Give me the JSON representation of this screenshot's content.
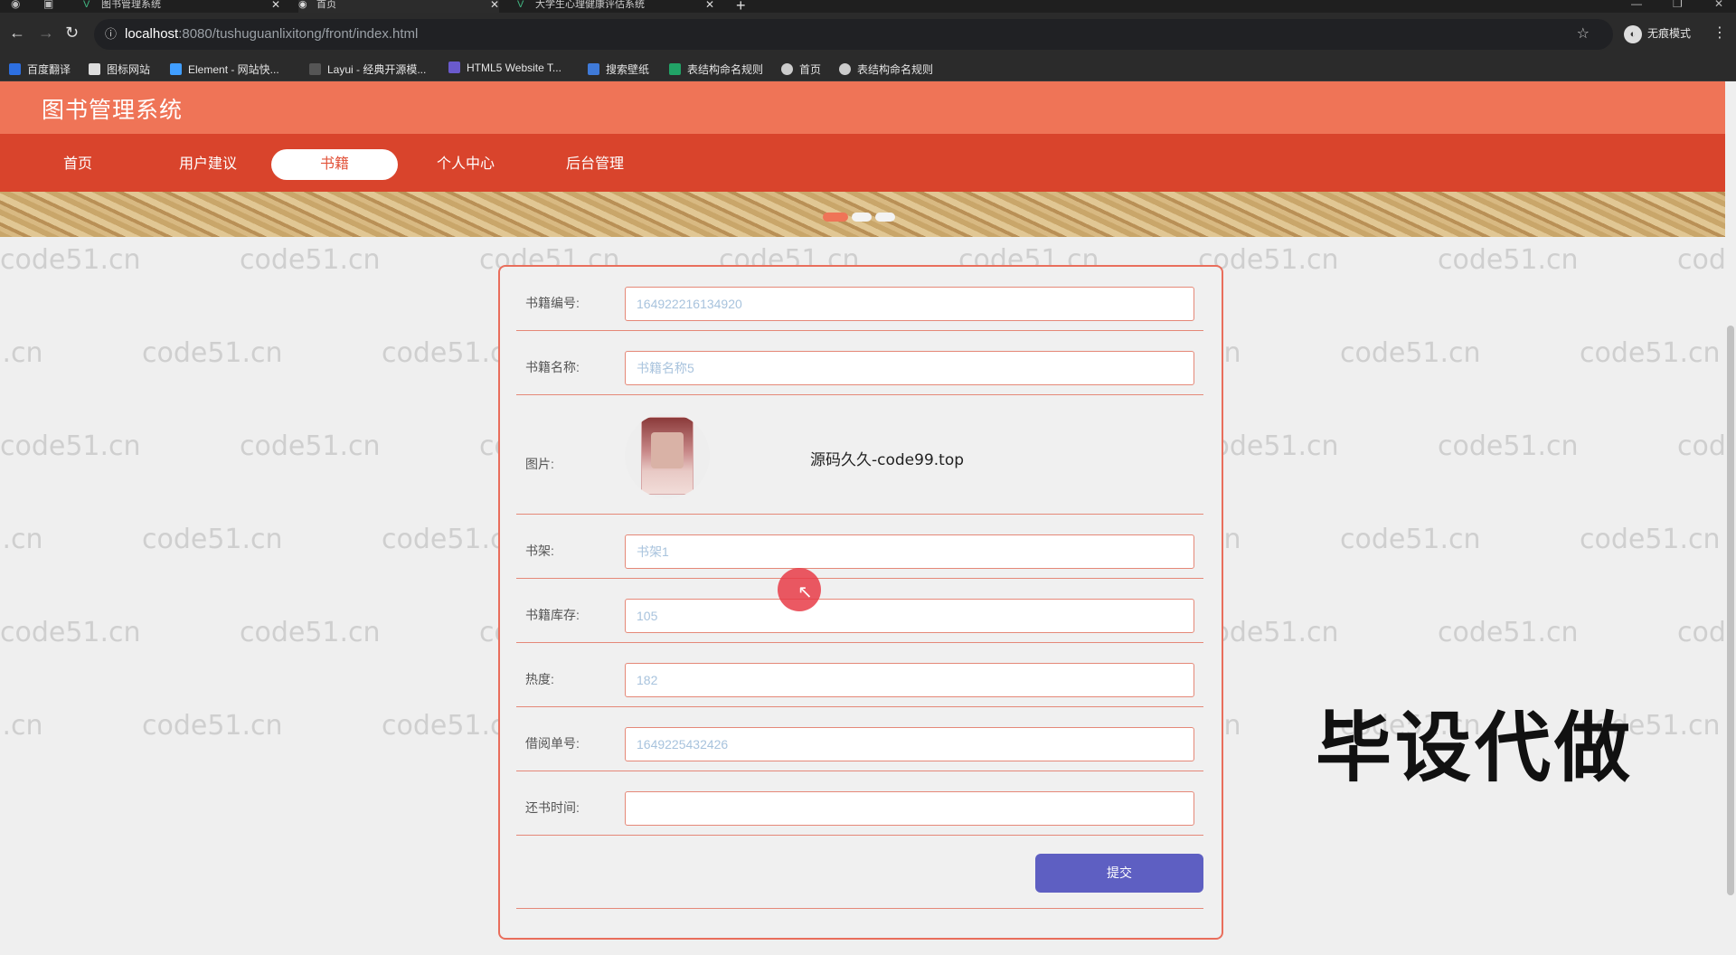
{
  "browser": {
    "tabs": [
      {
        "label": "图书管理系统"
      },
      {
        "label": "首页"
      },
      {
        "label": "大学生心理健康评估系统"
      }
    ],
    "url": {
      "host": "localhost",
      "rest": ":8080/tushuguanlixitong/front/index.html"
    },
    "profile": "无痕模式",
    "bookmarks": [
      "百度翻译",
      "图标网站",
      "Element - 网站快...",
      "Layui - 经典开源模...",
      "HTML5 Website T...",
      "搜索壁纸",
      "表结构命名规则",
      "首页",
      "表结构命名规则"
    ]
  },
  "site": {
    "title": "图书管理系统",
    "nav": [
      "首页",
      "用户建议",
      "书籍",
      "个人中心",
      "后台管理"
    ],
    "active_nav": "书籍"
  },
  "form": {
    "fields": [
      {
        "label": "书籍编号:",
        "value": "1649222161349​20"
      },
      {
        "label": "书籍名称:",
        "value": "书籍名称5"
      },
      {
        "label": "图片:",
        "value": ""
      },
      {
        "label": "书架:",
        "value": "书架1"
      },
      {
        "label": "书籍库存:",
        "value": "105"
      },
      {
        "label": "热度:",
        "value": "182"
      },
      {
        "label": "借阅单号:",
        "value": "1649225432426"
      },
      {
        "label": "还书时间:",
        "value": ""
      }
    ],
    "submit_label": "提交"
  },
  "overlay": {
    "caption": "源码久久-code99.top",
    "big_text": "毕设代做",
    "watermark": "code51.cn"
  },
  "colors": {
    "header": "#ef7457",
    "nav": "#d9442c",
    "button": "#5e5fc2",
    "border": "#e96e5c"
  }
}
